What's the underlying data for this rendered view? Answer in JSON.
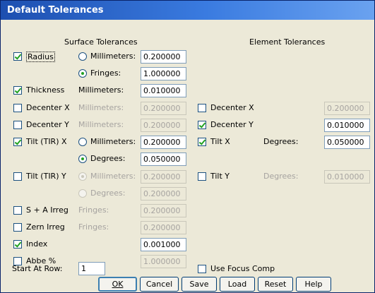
{
  "window": {
    "title": "Default Tolerances"
  },
  "headers": {
    "surface": "Surface Tolerances",
    "element": "Element Tolerances"
  },
  "surface": {
    "radius": {
      "label": "Radius",
      "checked": true,
      "mm_label": "Millimeters:",
      "mm_value": "0.200000",
      "fringes_label": "Fringes:",
      "fringes_value": "1.000000",
      "selected_unit": "Fringes"
    },
    "thickness": {
      "label": "Thickness",
      "checked": true,
      "unit_label": "Millimeters:",
      "value": "0.010000"
    },
    "decenter_x": {
      "label": "Decenter X",
      "checked": false,
      "unit_label": "Millimeters:",
      "value": "0.200000"
    },
    "decenter_y": {
      "label": "Decenter Y",
      "checked": false,
      "unit_label": "Millimeters:",
      "value": "0.200000"
    },
    "tilt_tir_x": {
      "label": "Tilt (TIR) X",
      "checked": true,
      "mm_label": "Millimeters:",
      "mm_value": "0.200000",
      "deg_label": "Degrees:",
      "deg_value": "0.050000",
      "selected_unit": "Degrees"
    },
    "tilt_tir_y": {
      "label": "Tilt (TIR) Y",
      "checked": false,
      "mm_label": "Millimeters:",
      "mm_value": "0.200000",
      "deg_label": "Degrees:",
      "deg_value": "0.200000",
      "selected_unit": "Millimeters"
    },
    "s_a_irreg": {
      "label": "S + A Irreg",
      "checked": false,
      "unit_label": "Fringes:",
      "value": "0.200000"
    },
    "zern_irreg": {
      "label": "Zern Irreg",
      "checked": false,
      "unit_label": "Fringes:",
      "value": "0.200000"
    },
    "index": {
      "label": "Index",
      "checked": true,
      "value": "0.001000"
    },
    "abbe": {
      "label": "Abbe %",
      "checked": false,
      "value": "1.000000"
    }
  },
  "element": {
    "decenter_x": {
      "label": "Decenter X",
      "checked": false,
      "value": "0.200000"
    },
    "decenter_y": {
      "label": "Decenter Y",
      "checked": true,
      "value": "0.010000"
    },
    "tilt_x": {
      "label": "Tilt X",
      "checked": true,
      "unit_label": "Degrees:",
      "value": "0.050000"
    },
    "tilt_y": {
      "label": "Tilt Y",
      "checked": false,
      "unit_label": "Degrees:",
      "value": "0.010000"
    }
  },
  "start_at_row": {
    "label": "Start At Row:",
    "value": "1"
  },
  "use_focus_comp": {
    "label": "Use Focus Comp",
    "checked": false
  },
  "buttons": {
    "ok": "OK",
    "cancel": "Cancel",
    "save": "Save",
    "load": "Load",
    "reset": "Reset",
    "help": "Help"
  },
  "colors": {
    "title_bar": "#1d4fb0",
    "dialog_bg": "#ece9d8",
    "check_mark": "#21a121"
  }
}
